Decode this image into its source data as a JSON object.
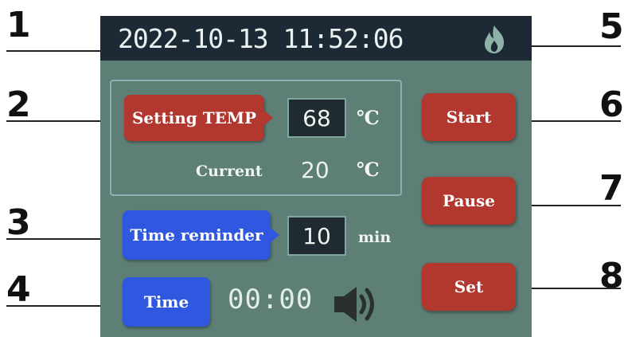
{
  "callouts": [
    "1",
    "2",
    "3",
    "4",
    "5",
    "6",
    "7",
    "8"
  ],
  "status_bar": {
    "datetime": "2022-10-13 11:52:06",
    "icon": "flame-icon"
  },
  "temperature": {
    "setting_label": "Setting TEMP",
    "setting_value": "68",
    "setting_unit": "℃",
    "current_label": "Current",
    "current_value": "20",
    "current_unit": "℃"
  },
  "reminder": {
    "label": "Time reminder",
    "value": "10",
    "unit": "min"
  },
  "timer": {
    "label": "Time",
    "value": "00:00",
    "icon": "speaker-icon"
  },
  "actions": {
    "start": "Start",
    "pause": "Pause",
    "set": "Set"
  },
  "colors": {
    "screen_bg": "#5e7f76",
    "status_bar_bg": "#1d2a35",
    "action_red": "#b2372e",
    "reminder_blue": "#2f57e0"
  }
}
